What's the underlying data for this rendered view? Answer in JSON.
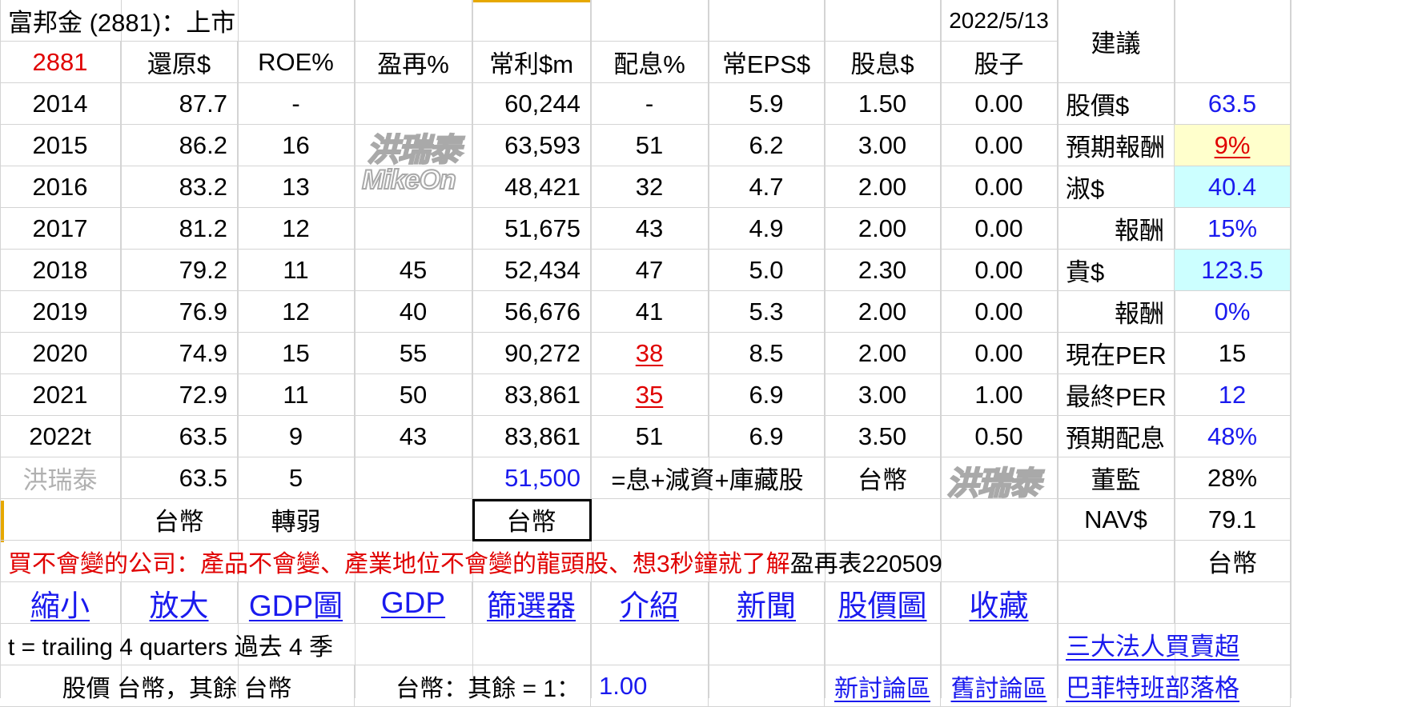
{
  "header": {
    "company": "富邦金 (2881)：上市",
    "date": "2022/5/13",
    "advice_header": "建議"
  },
  "table": {
    "code": "2881",
    "columns": [
      "還原$",
      "ROE%",
      "盈再%",
      "常利$m",
      "配息%",
      "常EPS$",
      "股息$",
      "股子"
    ],
    "rows": [
      {
        "year": "2014",
        "restore": "87.7",
        "roe": "-",
        "reinvest": "",
        "profit": "60,244",
        "payout": "-",
        "eps": "5.9",
        "dividend": "1.50",
        "stock_div": "0.00"
      },
      {
        "year": "2015",
        "restore": "86.2",
        "roe": "16",
        "reinvest": "",
        "profit": "63,593",
        "payout": "51",
        "eps": "6.2",
        "dividend": "3.00",
        "stock_div": "0.00"
      },
      {
        "year": "2016",
        "restore": "83.2",
        "roe": "13",
        "reinvest": "",
        "profit": "48,421",
        "payout": "32",
        "eps": "4.7",
        "dividend": "2.00",
        "stock_div": "0.00"
      },
      {
        "year": "2017",
        "restore": "81.2",
        "roe": "12",
        "reinvest": "",
        "profit": "51,675",
        "payout": "43",
        "eps": "4.9",
        "dividend": "2.00",
        "stock_div": "0.00"
      },
      {
        "year": "2018",
        "restore": "79.2",
        "roe": "11",
        "reinvest": "45",
        "profit": "52,434",
        "payout": "47",
        "eps": "5.0",
        "dividend": "2.30",
        "stock_div": "0.00"
      },
      {
        "year": "2019",
        "restore": "76.9",
        "roe": "12",
        "reinvest": "40",
        "profit": "56,676",
        "payout": "41",
        "eps": "5.3",
        "dividend": "2.00",
        "stock_div": "0.00"
      },
      {
        "year": "2020",
        "restore": "74.9",
        "roe": "15",
        "reinvest": "55",
        "profit": "90,272",
        "payout": "38",
        "eps": "8.5",
        "dividend": "2.00",
        "stock_div": "0.00"
      },
      {
        "year": "2021",
        "restore": "72.9",
        "roe": "11",
        "reinvest": "50",
        "profit": "83,861",
        "payout": "35",
        "eps": "6.9",
        "dividend": "3.00",
        "stock_div": "1.00"
      },
      {
        "year": "2022t",
        "restore": "63.5",
        "roe": "9",
        "reinvest": "43",
        "profit": "83,861",
        "payout": "51",
        "eps": "6.9",
        "dividend": "3.50",
        "stock_div": "0.50"
      }
    ],
    "summary": {
      "author": "洪瑞泰",
      "restore": "63.5",
      "roe": "5",
      "profit": "51,500",
      "formula": "=息+減資+庫藏股",
      "currency": "台幣"
    },
    "unit_row": {
      "restore_unit": "台幣",
      "roe_trend": "轉弱",
      "profit_unit": "台幣"
    }
  },
  "side": [
    {
      "label": "股價$",
      "value": "63.5"
    },
    {
      "label": "預期報酬",
      "value": "9%"
    },
    {
      "label": "淑$",
      "value": "40.4"
    },
    {
      "label": "報酬",
      "value": "15%"
    },
    {
      "label": "貴$",
      "value": "123.5"
    },
    {
      "label": "報酬",
      "value": "0%"
    },
    {
      "label": "現在PER",
      "value": "15"
    },
    {
      "label": "最終PER",
      "value": "12"
    },
    {
      "label": "預期配息",
      "value": "48%"
    },
    {
      "label": "董監",
      "value": "28%"
    },
    {
      "label": "NAV$",
      "value": "79.1"
    },
    {
      "label": "",
      "value": "台幣"
    }
  ],
  "banner": {
    "red_text": "買不會變的公司：產品不會變、產業地位不會變的龍頭股、想3秒鐘就了解",
    "black_text": "盈再表220509"
  },
  "links": [
    "縮小",
    "放大",
    "GDP圖",
    "GDP",
    "篩選器",
    "介紹",
    "新聞",
    "股價圖",
    "收藏"
  ],
  "footer": {
    "trailing_note": "t = trailing 4 quarters 過去 4 季",
    "institutional_link": "三大法人買賣超",
    "price_note": "股價 台幣，其餘 台幣",
    "ratio_label": "台幣：其餘 = 1：",
    "ratio_value": "1.00",
    "new_forum": "新討論區",
    "old_forum": "舊討論區",
    "blog": "巴菲特班部落格"
  },
  "watermarks": {
    "main": "洪瑞泰",
    "sub": "MikeOn"
  },
  "colors": {
    "red": "#e00000",
    "blue": "#1a1aee",
    "yellow_fill": "#ffffcc",
    "cyan_fill": "#ccffff",
    "grid": "#d4d4d4"
  }
}
